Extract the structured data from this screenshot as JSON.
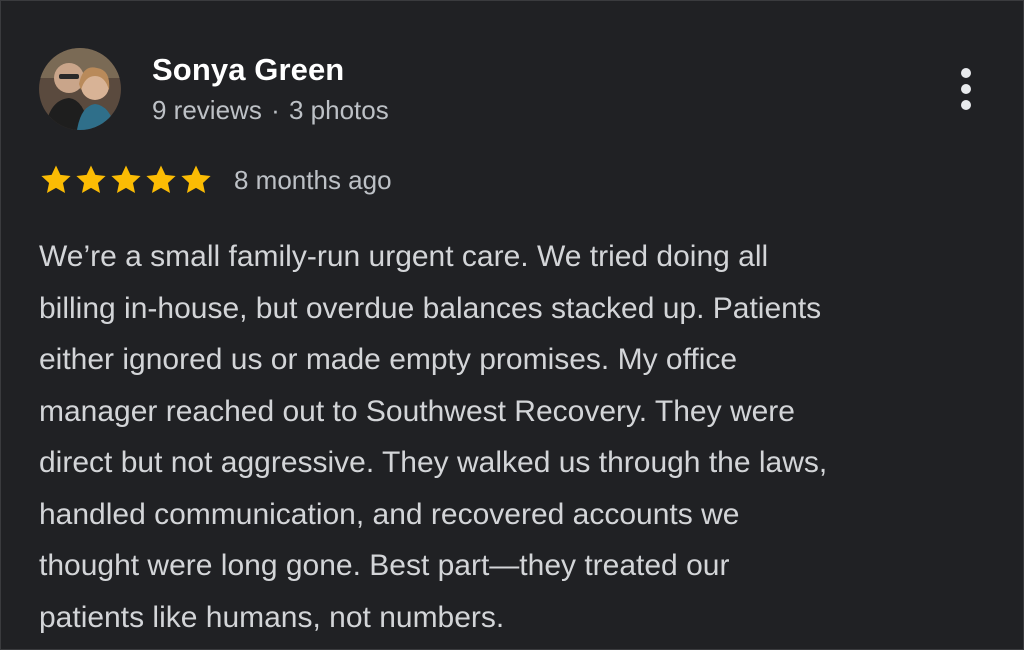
{
  "review": {
    "author_name": "Sonya Green",
    "reviews_count": "9 reviews",
    "separator": "·",
    "photos_count": "3 photos",
    "rating": 5,
    "rating_max": 5,
    "time_ago": "8 months ago",
    "text": "We’re a small family-run urgent care. We tried doing all\nbilling in-house, but overdue balances stacked up. Patients\neither ignored us or made empty promises. My office\nmanager reached out to Southwest Recovery. They were\ndirect but not aggressive. They walked us through the laws,\nhandled communication, and recovered accounts we\nthought were long gone. Best part—they treated our\npatients like humans, not numbers."
  },
  "icons": {
    "star": "star-icon",
    "more": "more-vert-icon"
  },
  "colors": {
    "background": "#202124",
    "star": "#fbbc04",
    "name": "#ffffff",
    "secondary_text": "#bdc1c6",
    "body_text": "#d3d5d8"
  }
}
